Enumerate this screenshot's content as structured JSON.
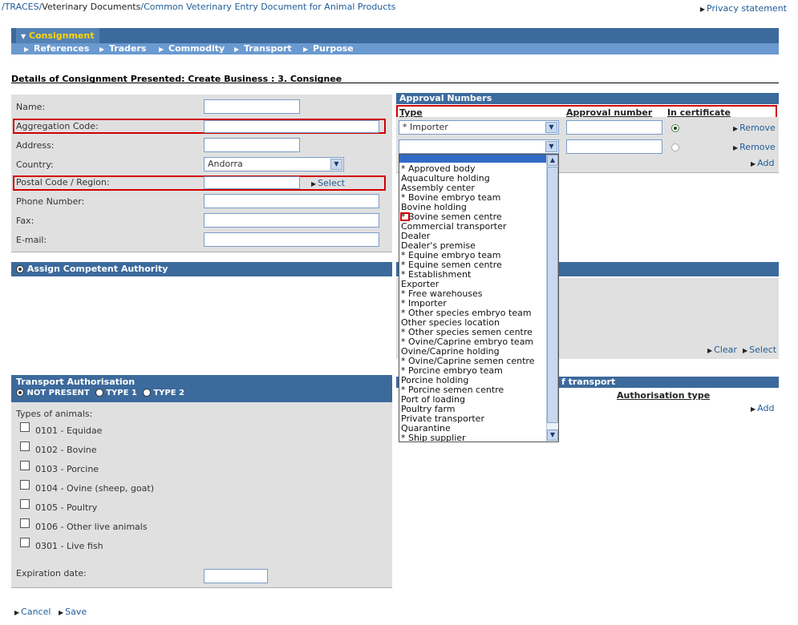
{
  "breadcrumb": {
    "part1": "/TRACES/",
    "part2": "Veterinary Documents",
    "part3": "/",
    "part4": "Common Veterinary Entry Document for Animal Products"
  },
  "privacy_link": "Privacy statement",
  "nav": {
    "active_tab": "Consignment",
    "subtabs": [
      "References",
      "Traders",
      "Commodity",
      "Transport",
      "Purpose"
    ]
  },
  "details_title": "Details of Consignment Presented: Create Business : 3. Consignee",
  "form": {
    "name_label": "Name:",
    "aggregation_label": "Aggregation Code:",
    "address_label": "Address:",
    "country_label": "Country:",
    "country_value": "Andorra",
    "postal_label": "Postal Code / Region:",
    "select_link": "Select",
    "phone_label": "Phone Number:",
    "fax_label": "Fax:",
    "email_label": "E-mail:"
  },
  "approval": {
    "header": "Approval Numbers",
    "col_type": "Type",
    "col_number": "Approval number",
    "col_cert": "In certificate",
    "row1_type": "* Importer",
    "remove_label": "Remove",
    "add_label": "Add"
  },
  "dropdown_options": [
    "* Approved body",
    "Aquaculture holding",
    "Assembly center",
    "* Bovine embryo team",
    "Bovine holding",
    "* Bovine semen centre",
    "Commercial transporter",
    "Dealer",
    "Dealer's premise",
    "* Equine embryo team",
    "* Equine semen centre",
    "* Establishment",
    "Exporter",
    "* Free warehouses",
    "* Importer",
    "* Other species embryo  team",
    "Other species location",
    "* Other species semen centre",
    "* Ovine/Caprine embryo  team",
    "Ovine/Caprine holding",
    "* Ovine/Caprine semen centre",
    "* Porcine embryo team",
    "Porcine holding",
    "* Porcine semen centre",
    "Port of loading",
    "Poultry farm",
    "Private transporter",
    "Quarantine",
    "* Ship supplier"
  ],
  "authority": {
    "header": "Assign Competent Authority",
    "clear_label": "Clear",
    "select_label": "Select"
  },
  "transport_auth": {
    "header": "Transport Authorisation",
    "opt_not_present": "NOT PRESENT",
    "opt_type1": "TYPE 1",
    "opt_type2": "TYPE 2",
    "types_label": "Types of animals:",
    "animals": [
      "0101 - Equidae",
      "0102 - Bovine",
      "0103 - Porcine",
      "0104 - Ovine (sheep, goat)",
      "0105 - Poultry",
      "0106 - Other live animals",
      "0301 - Live fish"
    ],
    "expiration_label": "Expiration date:"
  },
  "transport_right": {
    "header_partial": "f transport",
    "col_auth_type": "Authorisation type",
    "add_label": "Add"
  },
  "footer": {
    "cancel_label": "Cancel",
    "save_label": "Save"
  }
}
